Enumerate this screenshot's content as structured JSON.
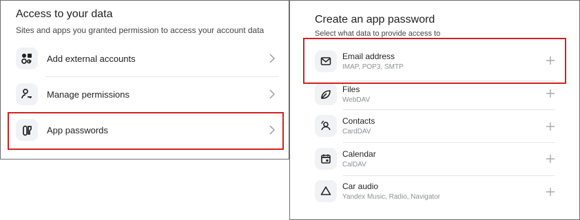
{
  "left": {
    "title": "Access to your data",
    "subtitle": "Sites and apps you granted permission to access your account data",
    "items": [
      {
        "label": "Add external accounts",
        "icon": "external-accounts-icon"
      },
      {
        "label": "Manage permissions",
        "icon": "user-key-icon"
      },
      {
        "label": "App passwords",
        "icon": "app-passwords-icon"
      }
    ]
  },
  "right": {
    "title": "Create an app password",
    "subtitle": "Select what data to provide access to",
    "items": [
      {
        "label": "Email address",
        "sub": "IMAP, POP3, SMTP",
        "icon": "envelope-icon"
      },
      {
        "label": "Files",
        "sub": "WebDAV",
        "icon": "leaf-icon"
      },
      {
        "label": "Contacts",
        "sub": "CardDAV",
        "icon": "contact-icon"
      },
      {
        "label": "Calendar",
        "sub": "CalDAV",
        "icon": "calendar-icon"
      },
      {
        "label": "Car audio",
        "sub": "Yandex Music, Radio, Navigator",
        "icon": "car-audio-icon"
      }
    ]
  },
  "colors": {
    "highlight": "#d21f1f",
    "icon_bg": "#f1f2f5",
    "subtext": "#8c8f96"
  }
}
